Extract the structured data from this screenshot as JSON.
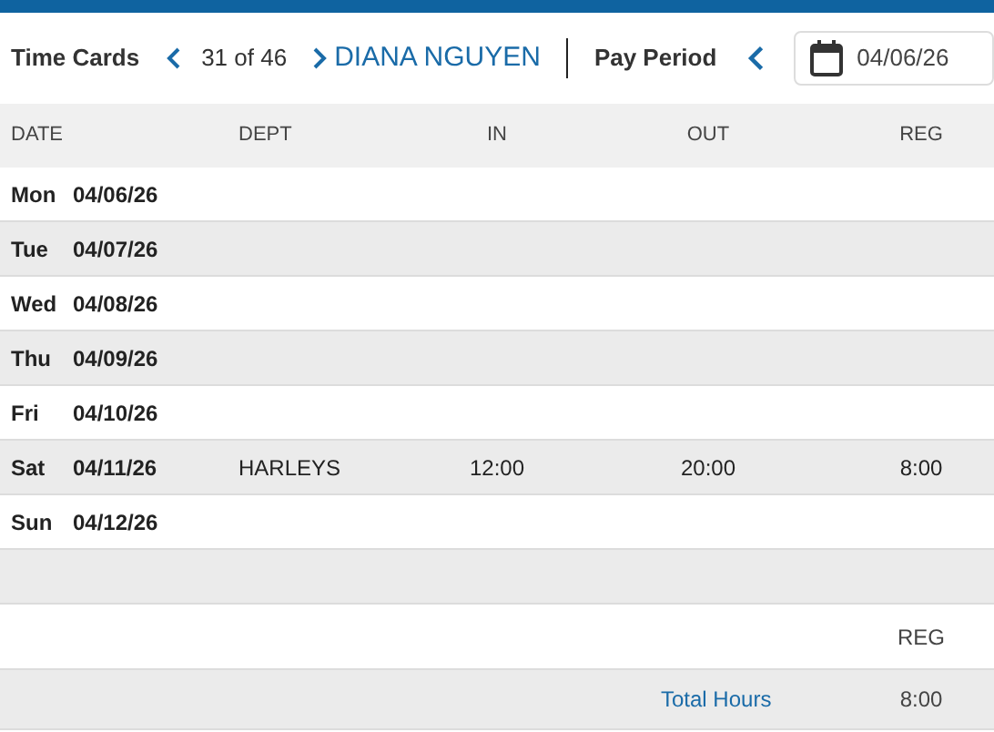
{
  "toolbar": {
    "title": "Time Cards",
    "counter": "31 of 46",
    "employee": "DIANA NGUYEN",
    "period_label": "Pay Period",
    "period_date": "04/06/26"
  },
  "table": {
    "columns": [
      "DATE",
      "DEPT",
      "IN",
      "OUT",
      "REG"
    ],
    "rows": [
      {
        "day": "Mon",
        "date": "04/06/26"
      },
      {
        "day": "Tue",
        "date": "04/07/26"
      },
      {
        "day": "Wed",
        "date": "04/08/26"
      },
      {
        "day": "Thu",
        "date": "04/09/26"
      },
      {
        "day": "Fri",
        "date": "04/10/26"
      },
      {
        "day": "Sat",
        "date": "04/11/26",
        "dept": "HARLEYS",
        "in": "12:00",
        "out": "20:00",
        "reg": "8:00"
      },
      {
        "day": "Sun",
        "date": "04/12/26"
      }
    ]
  },
  "summary": {
    "column": "REG",
    "label": "Total Hours",
    "total": "8:00"
  }
}
